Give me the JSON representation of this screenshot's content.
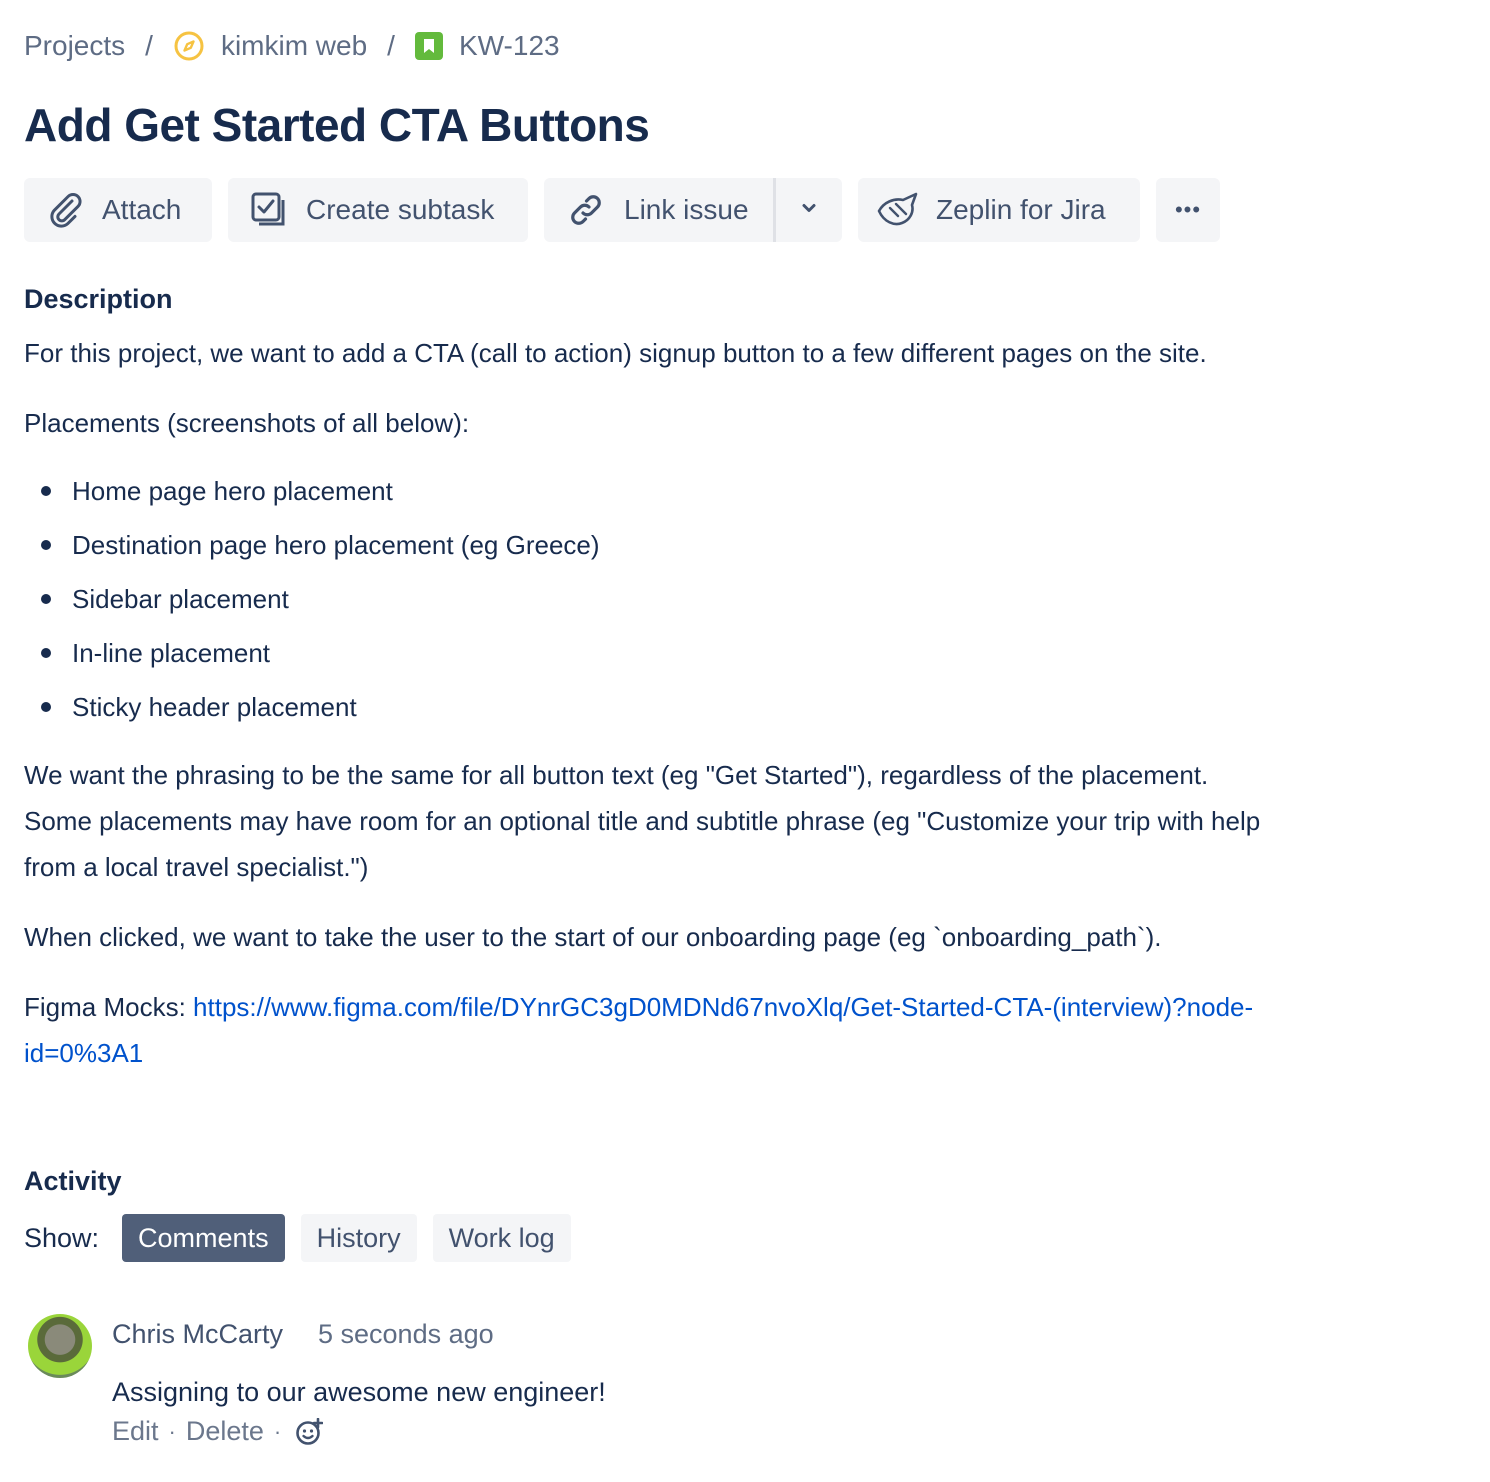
{
  "breadcrumb": {
    "projects": "Projects",
    "project_name": "kimkim web",
    "issue_key": "KW-123",
    "separator": "/"
  },
  "issue": {
    "title": "Add Get Started CTA Buttons"
  },
  "toolbar": {
    "attach": "Attach",
    "create_subtask": "Create subtask",
    "link_issue": "Link issue",
    "zeplin": "Zeplin for Jira",
    "more": "•••"
  },
  "description": {
    "heading": "Description",
    "p1": "For this project, we want to add a CTA (call to action) signup button to a few different pages on the site.",
    "p2": "Placements (screenshots of all below):",
    "bullets": [
      "Home page hero placement",
      "Destination page hero placement (eg Greece)",
      "Sidebar placement",
      "In-line placement",
      "Sticky header placement"
    ],
    "p3_line1": "We want the phrasing to be the same for all button text (eg \"Get Started\"), regardless of the placement.",
    "p3_line2": "Some placements may have room for an optional title and subtitle phrase (eg \"Customize your trip with help",
    "p3_line3": "from a local travel specialist.\")",
    "p4": "When clicked, we want to take the user to the start of our onboarding page (eg `onboarding_path`).",
    "figma_label": "Figma Mocks: ",
    "figma_link_line1": "https://www.figma.com/file/DYnrGC3gD0MDNd67nvoXlq/Get-Started-CTA-(interview)?node-",
    "figma_link_line2": "id=0%3A1"
  },
  "activity": {
    "heading": "Activity",
    "show_label": "Show:",
    "filters": [
      "Comments",
      "History",
      "Work log"
    ],
    "active_filter": "Comments"
  },
  "comment": {
    "author": "Chris McCarty",
    "time": "5 seconds ago",
    "body": "Assigning to our awesome new engineer!",
    "edit": "Edit",
    "delete": "Delete",
    "dot": "·"
  },
  "colors": {
    "text_primary": "#172b4d",
    "text_secondary": "#42526e",
    "link": "#0052cc",
    "button_bg": "#f4f5f7",
    "active_filter_bg": "#505f79",
    "project_icon": "#f6c342",
    "story_icon": "#63ba3c"
  },
  "icons": {
    "project": "compass-icon",
    "issue_type": "story-bookmark-icon",
    "attach": "paperclip-icon",
    "subtask": "subtask-icon",
    "link": "link-icon",
    "dropdown": "chevron-down-icon",
    "zeplin": "zeplin-icon",
    "reaction": "add-reaction-icon"
  }
}
